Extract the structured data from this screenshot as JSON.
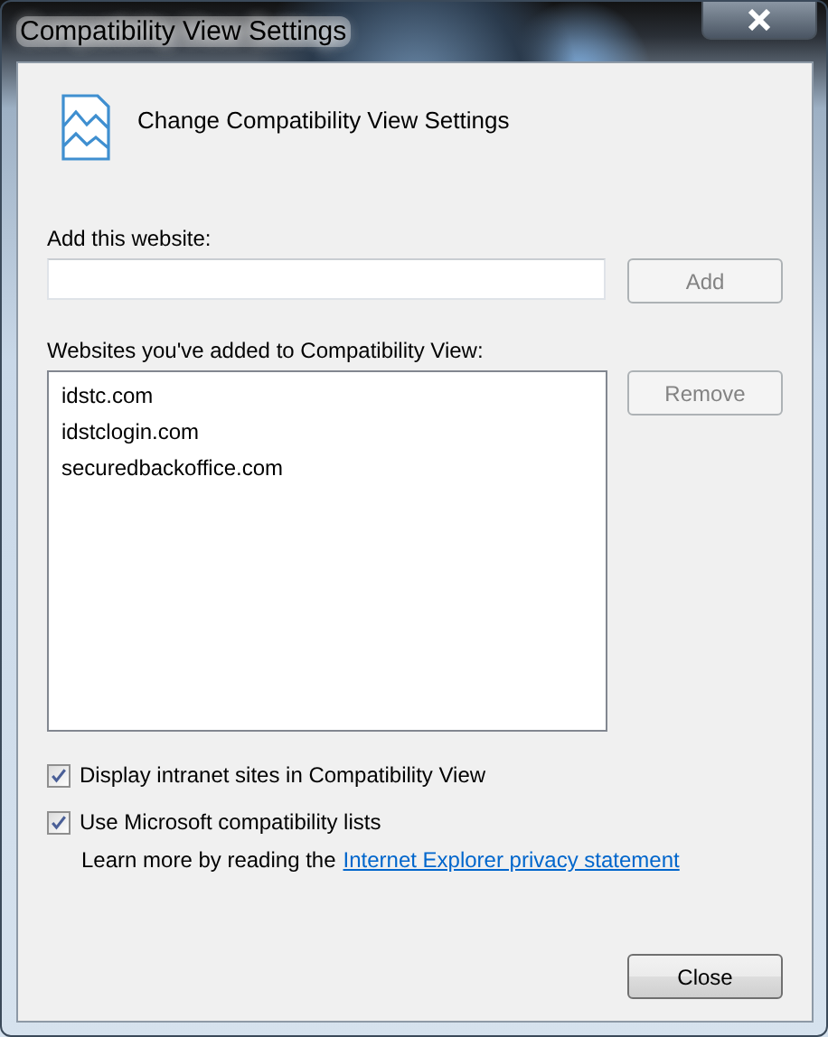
{
  "window": {
    "title": "Compatibility View Settings"
  },
  "header": {
    "title": "Change Compatibility View Settings"
  },
  "add_website": {
    "label": "Add this website:",
    "button": {
      "label": "Add",
      "disabled": true
    }
  },
  "websites": {
    "label": "Websites you've added to Compatibility View:",
    "items": [
      {
        "label": "idstc.com",
        "selected": false
      },
      {
        "label": "idstclogin.com",
        "selected": false
      },
      {
        "label": "securedbackoffice.com",
        "selected": false
      }
    ],
    "button": {
      "label": "Remove",
      "disabled": true
    }
  },
  "options": [
    {
      "label": "Display intranet sites in Compatibility View",
      "checked": true
    },
    {
      "label": "Use Microsoft compatibility lists",
      "checked": true
    }
  ],
  "privacy": {
    "text": "Learn more by reading the",
    "link": "Internet Explorer privacy statement"
  },
  "buttons": [
    {
      "label": "Close",
      "disabled": false
    }
  ]
}
